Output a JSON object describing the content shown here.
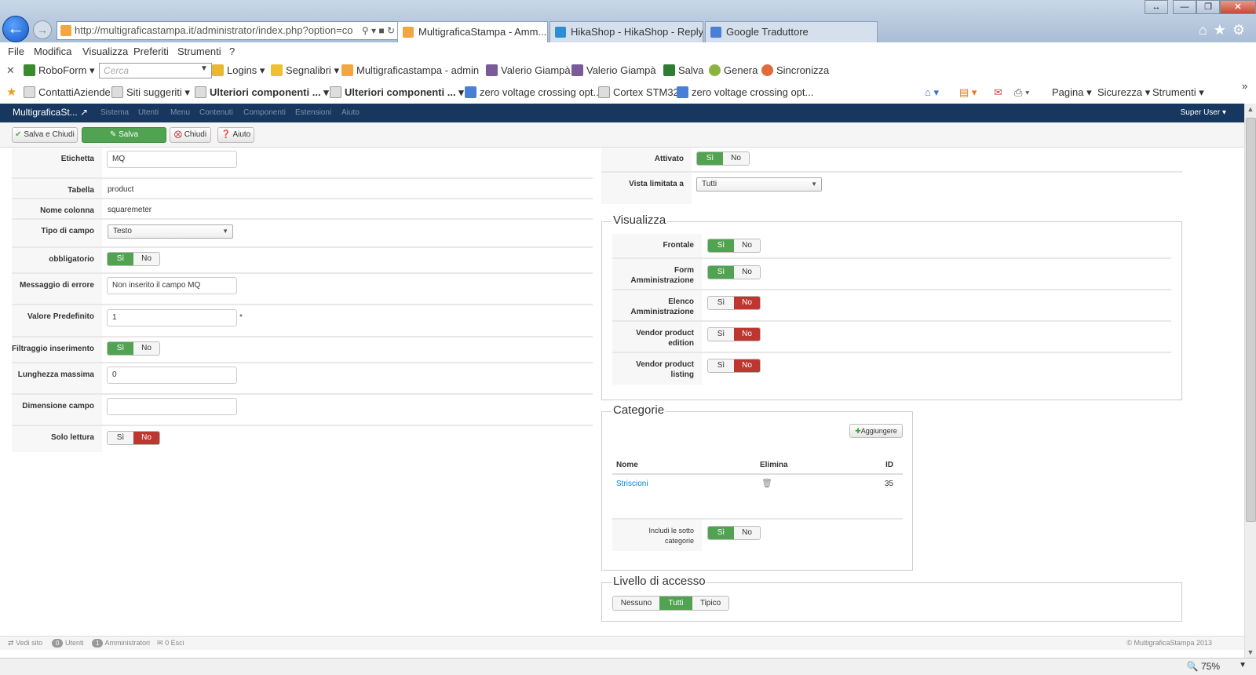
{
  "browser": {
    "url": "http://multigraficastampa.it/administrator/index.php?option=co",
    "tabs": [
      {
        "label": "MultigraficaStampa - Amm...",
        "close": "✕"
      },
      {
        "label": "HikaShop - HikaShop - Reply T..."
      },
      {
        "label": "Google Traduttore"
      }
    ],
    "menu": [
      "File",
      "Modifica",
      "Visualizza",
      "Preferiti",
      "Strumenti",
      "?"
    ],
    "toolbar1": {
      "roboform": "RoboForm",
      "search_placeholder": "Cerca",
      "logins": "Logins",
      "segnalibri": "Segnalibri",
      "site_admin": "Multigraficastampa - admin",
      "user1": "Valerio Giampà",
      "user2": "Valerio Giampà",
      "salva": "Salva",
      "genera": "Genera",
      "sincronizza": "Sincronizza"
    },
    "favorites": {
      "items": [
        "ContattiAziende",
        "Siti suggeriti",
        "Ulteriori componenti ...",
        "Ulteriori componenti ...",
        "zero voltage crossing opt...",
        "Cortex STM32",
        "zero voltage crossing opt..."
      ],
      "pagina": "Pagina",
      "sicurezza": "Sicurezza",
      "strumenti": "Strumenti"
    },
    "zoom": "75%"
  },
  "admin": {
    "site_name": "MultigraficaSt...",
    "menu": [
      "Sistema",
      "Utenti",
      "Menu",
      "Contenuti",
      "Componenti",
      "Estensioni",
      "Aiuto"
    ],
    "user": "Super User",
    "buttons": {
      "save_close": "Salva e Chiudi",
      "save": "Salva",
      "close": "Chiudi",
      "help": "Aiuto"
    },
    "footer": {
      "view_site": "Vedi sito",
      "users_count": "0",
      "users_label": "Utenti",
      "admins_count": "1",
      "admins_label": "Amministratori",
      "logout": "0 Esci",
      "copyright": "© MultigraficaStampa 2013"
    }
  },
  "form_left": {
    "etichetta": {
      "label": "Etichetta",
      "value": "MQ"
    },
    "tabella": {
      "label": "Tabella",
      "value": "product"
    },
    "nome_colonna": {
      "label": "Nome colonna",
      "value": "squaremeter"
    },
    "tipo_campo": {
      "label": "Tipo di campo",
      "value": "Testo"
    },
    "obbligatorio": {
      "label": "obbligatorio",
      "yes": "Sì",
      "no": "No"
    },
    "messaggio_errore": {
      "label": "Messaggio di errore",
      "value": "Non inserito il campo MQ"
    },
    "valore_predefinito": {
      "label": "Valore Predefinito",
      "value": "1",
      "asterisk": "*"
    },
    "filtraggio": {
      "label": "Filtraggio inserimento",
      "yes": "Sì",
      "no": "No"
    },
    "lunghezza_massima": {
      "label": "Lunghezza massima",
      "value": "0"
    },
    "dimensione_campo": {
      "label": "Dimensione campo",
      "value": ""
    },
    "solo_lettura": {
      "label": "Solo lettura",
      "yes": "Sì",
      "no": "No"
    }
  },
  "form_right": {
    "attivato": {
      "label": "Attivato",
      "yes": "Sì",
      "no": "No"
    },
    "vista_limitata": {
      "label": "Vista limitata a",
      "value": "Tutti"
    },
    "visualizza": {
      "legend": "Visualizza",
      "frontale": {
        "label": "Frontale",
        "yes": "Sì",
        "no": "No"
      },
      "form_admin": {
        "label1": "Form",
        "label2": "Amministrazione",
        "yes": "Sì",
        "no": "No"
      },
      "elenco_admin": {
        "label1": "Elenco",
        "label2": "Amministrazione",
        "yes": "Sì",
        "no": "No"
      },
      "vendor_edition": {
        "label1": "Vendor product",
        "label2": "edition",
        "yes": "Sì",
        "no": "No"
      },
      "vendor_listing": {
        "label": "Vendor product listing",
        "yes": "Sì",
        "no": "No"
      }
    },
    "categorie": {
      "legend": "Categorie",
      "add_button": "Aggiungere",
      "headers": {
        "nome": "Nome",
        "elimina": "Elimina",
        "id": "ID"
      },
      "rows": [
        {
          "nome": "Striscioni",
          "id": "35"
        }
      ],
      "includi": {
        "label1": "Includi le sotto",
        "label2": "categorie",
        "yes": "Sì",
        "no": "No"
      }
    },
    "livello": {
      "legend": "Livello di accesso",
      "options": [
        "Nessuno",
        "Tutti",
        "Tipico"
      ]
    }
  },
  "colors": {
    "green": "#51a351",
    "red": "#bd362f",
    "admin_bar": "#17375e",
    "link": "#0088cc"
  }
}
